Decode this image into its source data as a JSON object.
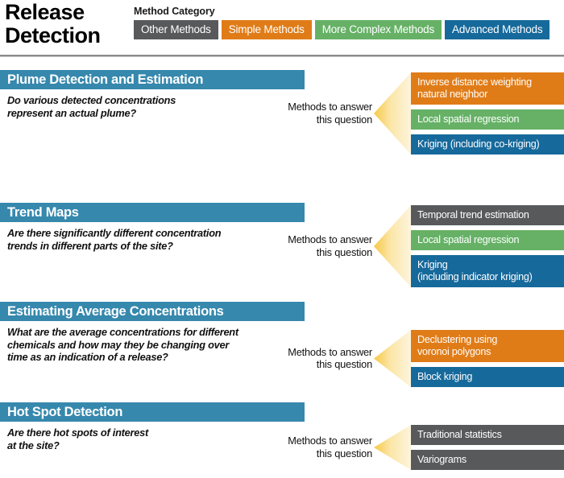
{
  "title": "Release\nDetection",
  "legend": {
    "heading": "Method Category",
    "items": [
      {
        "label": "Other Methods",
        "color": "#58595b"
      },
      {
        "label": "Simple Methods",
        "color": "#e07c18"
      },
      {
        "label": "More Complex Methods",
        "color": "#66b166"
      },
      {
        "label": "Advanced Methods",
        "color": "#16699b"
      }
    ]
  },
  "cta": "Methods to answer\nthis question",
  "colors": {
    "section_header": "#3688ad",
    "divider": "#8c8c8c",
    "arrow_light": "#fdf4dd",
    "arrow_dark": "#f7c948"
  },
  "sections": [
    {
      "heading": "Plume Detection and Estimation",
      "question": "Do various detected concentrations\nrepresent an actual plume?",
      "methods": [
        {
          "label": "Inverse distance weighting\nnatural neighbor",
          "category": "Simple Methods",
          "color": "#e07c18",
          "lines": 2
        },
        {
          "label": "Local spatial regression",
          "category": "More Complex Methods",
          "color": "#66b166",
          "lines": 1
        },
        {
          "label": "Kriging (including co-kriging)",
          "category": "Advanced Methods",
          "color": "#16699b",
          "lines": 1
        }
      ]
    },
    {
      "heading": "Trend Maps",
      "question": "Are there significantly different concentration\ntrends in different parts of the site?",
      "methods": [
        {
          "label": "Temporal trend estimation",
          "category": "Other Methods",
          "color": "#58595b",
          "lines": 1
        },
        {
          "label": "Local spatial regression",
          "category": "More Complex Methods",
          "color": "#66b166",
          "lines": 1
        },
        {
          "label": "Kriging\n(including indicator kriging)",
          "category": "Advanced Methods",
          "color": "#16699b",
          "lines": 2
        }
      ]
    },
    {
      "heading": "Estimating Average Concentrations",
      "question": "What are the average concentrations for different\nchemicals and how may they be changing over\ntime as an indication of a release?",
      "methods": [
        {
          "label": "Declustering using\nvoronoi polygons",
          "category": "Simple Methods",
          "color": "#e07c18",
          "lines": 2
        },
        {
          "label": "Block kriging",
          "category": "Advanced Methods",
          "color": "#16699b",
          "lines": 1
        }
      ]
    },
    {
      "heading": "Hot Spot Detection",
      "question": "Are there hot spots of interest\nat the site?",
      "methods": [
        {
          "label": "Traditional statistics",
          "category": "Other Methods",
          "color": "#58595b",
          "lines": 1
        },
        {
          "label": "Variograms",
          "category": "Other Methods",
          "color": "#58595b",
          "lines": 1
        }
      ]
    }
  ]
}
